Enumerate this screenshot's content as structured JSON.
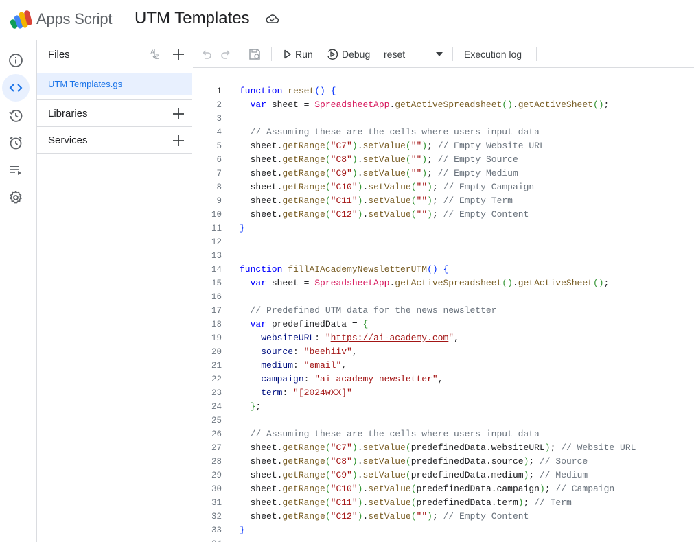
{
  "header": {
    "app_name": "Apps Script",
    "project_title": "UTM Templates",
    "cloud_icon": "cloud-saved-icon"
  },
  "rail": {
    "items": [
      {
        "icon": "info-icon",
        "label": "Overview"
      },
      {
        "icon": "code-icon",
        "label": "Editor",
        "active": true
      },
      {
        "icon": "history-icon",
        "label": "Project History"
      },
      {
        "icon": "alarm-icon",
        "label": "Triggers"
      },
      {
        "icon": "executions-icon",
        "label": "Executions"
      },
      {
        "icon": "gear-icon",
        "label": "Project Settings"
      }
    ]
  },
  "files_panel": {
    "title": "Files",
    "files": [
      {
        "name": "UTM Templates.gs"
      }
    ],
    "sections": [
      {
        "label": "Libraries"
      },
      {
        "label": "Services"
      }
    ]
  },
  "toolbar": {
    "run_label": "Run",
    "debug_label": "Debug",
    "function_selected": "reset",
    "execution_log_label": "Execution log"
  },
  "editor": {
    "active_line": 1,
    "lines": [
      [
        [
          "kw",
          "function"
        ],
        [
          "t",
          " "
        ],
        [
          "fn",
          "reset"
        ],
        [
          "b1",
          "()"
        ],
        [
          "t",
          " "
        ],
        [
          "b1",
          "{"
        ]
      ],
      [
        [
          "t",
          "  "
        ],
        [
          "kw",
          "var"
        ],
        [
          "t",
          " sheet = "
        ],
        [
          "cls",
          "SpreadsheetApp"
        ],
        [
          "t",
          "."
        ],
        [
          "fn",
          "getActiveSpreadsheet"
        ],
        [
          "b2",
          "()"
        ],
        [
          "t",
          "."
        ],
        [
          "fn",
          "getActiveSheet"
        ],
        [
          "b2",
          "()"
        ],
        [
          "t",
          ";"
        ]
      ],
      [],
      [
        [
          "t",
          "  "
        ],
        [
          "cm",
          "// Assuming these are the cells where users input data"
        ]
      ],
      [
        [
          "t",
          "  sheet."
        ],
        [
          "fn",
          "getRange"
        ],
        [
          "b2",
          "("
        ],
        [
          "str",
          "\"C7\""
        ],
        [
          "b2",
          ")"
        ],
        [
          "t",
          "."
        ],
        [
          "fn",
          "setValue"
        ],
        [
          "b2",
          "("
        ],
        [
          "str",
          "\"\""
        ],
        [
          "b2",
          ")"
        ],
        [
          "t",
          "; "
        ],
        [
          "cm",
          "// Empty Website URL"
        ]
      ],
      [
        [
          "t",
          "  sheet."
        ],
        [
          "fn",
          "getRange"
        ],
        [
          "b2",
          "("
        ],
        [
          "str",
          "\"C8\""
        ],
        [
          "b2",
          ")"
        ],
        [
          "t",
          "."
        ],
        [
          "fn",
          "setValue"
        ],
        [
          "b2",
          "("
        ],
        [
          "str",
          "\"\""
        ],
        [
          "b2",
          ")"
        ],
        [
          "t",
          "; "
        ],
        [
          "cm",
          "// Empty Source"
        ]
      ],
      [
        [
          "t",
          "  sheet."
        ],
        [
          "fn",
          "getRange"
        ],
        [
          "b2",
          "("
        ],
        [
          "str",
          "\"C9\""
        ],
        [
          "b2",
          ")"
        ],
        [
          "t",
          "."
        ],
        [
          "fn",
          "setValue"
        ],
        [
          "b2",
          "("
        ],
        [
          "str",
          "\"\""
        ],
        [
          "b2",
          ")"
        ],
        [
          "t",
          "; "
        ],
        [
          "cm",
          "// Empty Medium"
        ]
      ],
      [
        [
          "t",
          "  sheet."
        ],
        [
          "fn",
          "getRange"
        ],
        [
          "b2",
          "("
        ],
        [
          "str",
          "\"C10\""
        ],
        [
          "b2",
          ")"
        ],
        [
          "t",
          "."
        ],
        [
          "fn",
          "setValue"
        ],
        [
          "b2",
          "("
        ],
        [
          "str",
          "\"\""
        ],
        [
          "b2",
          ")"
        ],
        [
          "t",
          "; "
        ],
        [
          "cm",
          "// Empty Campaign"
        ]
      ],
      [
        [
          "t",
          "  sheet."
        ],
        [
          "fn",
          "getRange"
        ],
        [
          "b2",
          "("
        ],
        [
          "str",
          "\"C11\""
        ],
        [
          "b2",
          ")"
        ],
        [
          "t",
          "."
        ],
        [
          "fn",
          "setValue"
        ],
        [
          "b2",
          "("
        ],
        [
          "str",
          "\"\""
        ],
        [
          "b2",
          ")"
        ],
        [
          "t",
          "; "
        ],
        [
          "cm",
          "// Empty Term"
        ]
      ],
      [
        [
          "t",
          "  sheet."
        ],
        [
          "fn",
          "getRange"
        ],
        [
          "b2",
          "("
        ],
        [
          "str",
          "\"C12\""
        ],
        [
          "b2",
          ")"
        ],
        [
          "t",
          "."
        ],
        [
          "fn",
          "setValue"
        ],
        [
          "b2",
          "("
        ],
        [
          "str",
          "\"\""
        ],
        [
          "b2",
          ")"
        ],
        [
          "t",
          "; "
        ],
        [
          "cm",
          "// Empty Content"
        ]
      ],
      [
        [
          "b1",
          "}"
        ]
      ],
      [],
      [],
      [
        [
          "kw",
          "function"
        ],
        [
          "t",
          " "
        ],
        [
          "fn",
          "fillAIAcademyNewsletterUTM"
        ],
        [
          "b1",
          "()"
        ],
        [
          "t",
          " "
        ],
        [
          "b1",
          "{"
        ]
      ],
      [
        [
          "t",
          "  "
        ],
        [
          "kw",
          "var"
        ],
        [
          "t",
          " sheet = "
        ],
        [
          "cls",
          "SpreadsheetApp"
        ],
        [
          "t",
          "."
        ],
        [
          "fn",
          "getActiveSpreadsheet"
        ],
        [
          "b2",
          "()"
        ],
        [
          "t",
          "."
        ],
        [
          "fn",
          "getActiveSheet"
        ],
        [
          "b2",
          "()"
        ],
        [
          "t",
          ";"
        ]
      ],
      [],
      [
        [
          "t",
          "  "
        ],
        [
          "cm",
          "// Predefined UTM data for the news newsletter"
        ]
      ],
      [
        [
          "t",
          "  "
        ],
        [
          "kw",
          "var"
        ],
        [
          "t",
          " predefinedData = "
        ],
        [
          "b2",
          "{"
        ]
      ],
      [
        [
          "t",
          "    "
        ],
        [
          "prop",
          "websiteURL"
        ],
        [
          "t",
          ": "
        ],
        [
          "str",
          "\""
        ],
        [
          "url",
          "https://ai-academy.com"
        ],
        [
          "str",
          "\""
        ],
        [
          "t",
          ","
        ]
      ],
      [
        [
          "t",
          "    "
        ],
        [
          "prop",
          "source"
        ],
        [
          "t",
          ": "
        ],
        [
          "str",
          "\"beehiiv\""
        ],
        [
          "t",
          ","
        ]
      ],
      [
        [
          "t",
          "    "
        ],
        [
          "prop",
          "medium"
        ],
        [
          "t",
          ": "
        ],
        [
          "str",
          "\"email\""
        ],
        [
          "t",
          ","
        ]
      ],
      [
        [
          "t",
          "    "
        ],
        [
          "prop",
          "campaign"
        ],
        [
          "t",
          ": "
        ],
        [
          "str",
          "\"ai academy newsletter\""
        ],
        [
          "t",
          ","
        ]
      ],
      [
        [
          "t",
          "    "
        ],
        [
          "prop",
          "term"
        ],
        [
          "t",
          ": "
        ],
        [
          "str",
          "\"[2024wXX]\""
        ]
      ],
      [
        [
          "t",
          "  "
        ],
        [
          "b2",
          "}"
        ],
        [
          "t",
          ";"
        ]
      ],
      [],
      [
        [
          "t",
          "  "
        ],
        [
          "cm",
          "// Assuming these are the cells where users input data"
        ]
      ],
      [
        [
          "t",
          "  sheet."
        ],
        [
          "fn",
          "getRange"
        ],
        [
          "b2",
          "("
        ],
        [
          "str",
          "\"C7\""
        ],
        [
          "b2",
          ")"
        ],
        [
          "t",
          "."
        ],
        [
          "fn",
          "setValue"
        ],
        [
          "b2",
          "("
        ],
        [
          "t",
          "predefinedData.websiteURL"
        ],
        [
          "b2",
          ")"
        ],
        [
          "t",
          "; "
        ],
        [
          "cm",
          "// Website URL"
        ]
      ],
      [
        [
          "t",
          "  sheet."
        ],
        [
          "fn",
          "getRange"
        ],
        [
          "b2",
          "("
        ],
        [
          "str",
          "\"C8\""
        ],
        [
          "b2",
          ")"
        ],
        [
          "t",
          "."
        ],
        [
          "fn",
          "setValue"
        ],
        [
          "b2",
          "("
        ],
        [
          "t",
          "predefinedData.source"
        ],
        [
          "b2",
          ")"
        ],
        [
          "t",
          "; "
        ],
        [
          "cm",
          "// Source"
        ]
      ],
      [
        [
          "t",
          "  sheet."
        ],
        [
          "fn",
          "getRange"
        ],
        [
          "b2",
          "("
        ],
        [
          "str",
          "\"C9\""
        ],
        [
          "b2",
          ")"
        ],
        [
          "t",
          "."
        ],
        [
          "fn",
          "setValue"
        ],
        [
          "b2",
          "("
        ],
        [
          "t",
          "predefinedData.medium"
        ],
        [
          "b2",
          ")"
        ],
        [
          "t",
          "; "
        ],
        [
          "cm",
          "// Medium"
        ]
      ],
      [
        [
          "t",
          "  sheet."
        ],
        [
          "fn",
          "getRange"
        ],
        [
          "b2",
          "("
        ],
        [
          "str",
          "\"C10\""
        ],
        [
          "b2",
          ")"
        ],
        [
          "t",
          "."
        ],
        [
          "fn",
          "setValue"
        ],
        [
          "b2",
          "("
        ],
        [
          "t",
          "predefinedData.campaign"
        ],
        [
          "b2",
          ")"
        ],
        [
          "t",
          "; "
        ],
        [
          "cm",
          "// Campaign"
        ]
      ],
      [
        [
          "t",
          "  sheet."
        ],
        [
          "fn",
          "getRange"
        ],
        [
          "b2",
          "("
        ],
        [
          "str",
          "\"C11\""
        ],
        [
          "b2",
          ")"
        ],
        [
          "t",
          "."
        ],
        [
          "fn",
          "setValue"
        ],
        [
          "b2",
          "("
        ],
        [
          "t",
          "predefinedData.term"
        ],
        [
          "b2",
          ")"
        ],
        [
          "t",
          "; "
        ],
        [
          "cm",
          "// Term"
        ]
      ],
      [
        [
          "t",
          "  sheet."
        ],
        [
          "fn",
          "getRange"
        ],
        [
          "b2",
          "("
        ],
        [
          "str",
          "\"C12\""
        ],
        [
          "b2",
          ")"
        ],
        [
          "t",
          "."
        ],
        [
          "fn",
          "setValue"
        ],
        [
          "b2",
          "("
        ],
        [
          "str",
          "\"\""
        ],
        [
          "b2",
          ")"
        ],
        [
          "t",
          "; "
        ],
        [
          "cm",
          "// Empty Content"
        ]
      ],
      [
        [
          "b1",
          "}"
        ]
      ],
      []
    ]
  },
  "colors": {
    "accent": "#1a73e8",
    "selected_bg": "#e8f0fe",
    "border": "#dadce0"
  }
}
